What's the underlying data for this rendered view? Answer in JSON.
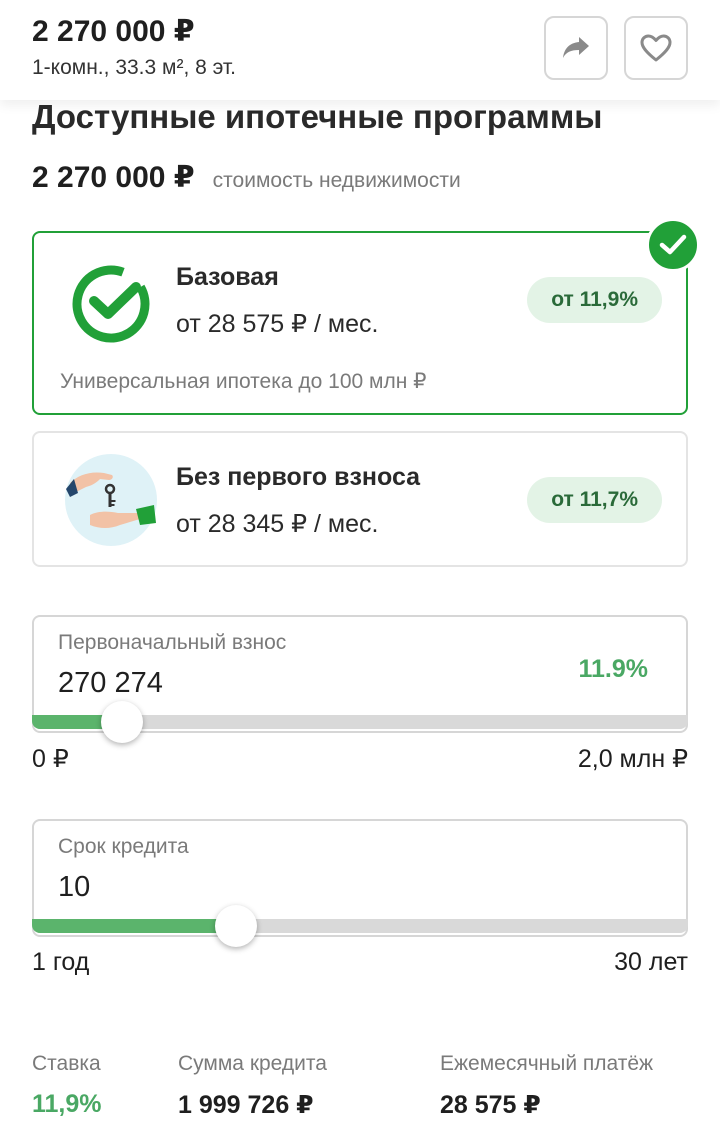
{
  "header": {
    "price": "2 270 000 ₽",
    "subtitle": "1-комн., 33.3 м², 8 эт.",
    "share_icon": "share-arrow-icon",
    "favorite_icon": "heart-icon"
  },
  "section": {
    "title": "Доступные ипотечные программы",
    "property_price": "2 270 000 ₽",
    "property_price_caption": "стоимость недвижимости"
  },
  "programs": [
    {
      "title": "Базовая",
      "payment": "от 28 575 ₽ / мес.",
      "rate": "от 11,9%",
      "description": "Универсальная ипотека до 100 млн ₽",
      "icon": "sber-check-logo-icon",
      "selected": true
    },
    {
      "title": "Без первого взноса",
      "payment": "от 28 345 ₽ / мес.",
      "rate": "от 11,7%",
      "icon": "hands-with-keys-icon",
      "selected": false
    }
  ],
  "down_payment": {
    "label": "Первоначальный взнос",
    "value": "270 274",
    "percent": "11.9%",
    "min_label": "0 ₽",
    "max_label": "2,0 млн ₽",
    "level": 0.135
  },
  "loan_term": {
    "label": "Срок кредита",
    "value": "10",
    "min_label": "1 год",
    "max_label": "30 лет",
    "level": 0.31
  },
  "summary": {
    "rate_label": "Ставка",
    "rate_value": "11,9%",
    "loan_label": "Сумма кредита",
    "loan_value": "1 999 726 ₽",
    "monthly_label": "Ежемесячный платёж",
    "monthly_value": "28 575 ₽"
  },
  "colors": {
    "accent": "#21a038",
    "accent_light": "#5bb46c",
    "badge_bg": "#e3f3e6",
    "text_muted": "#7a7a7a"
  }
}
